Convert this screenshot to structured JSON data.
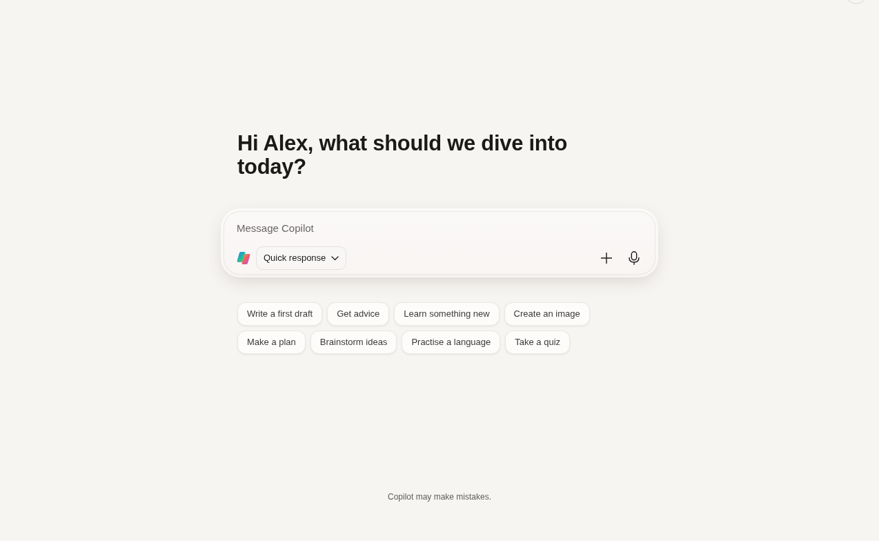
{
  "greeting": {
    "title": "Hi Alex, what should we dive into today?"
  },
  "composer": {
    "placeholder": "Message Copilot",
    "mode_dropdown": {
      "label": "Quick response"
    }
  },
  "suggestion_rows": [
    {
      "chips": [
        {
          "label": "Write a first draft"
        },
        {
          "label": "Get advice"
        },
        {
          "label": "Learn something new"
        },
        {
          "label": "Create an image"
        }
      ]
    },
    {
      "chips": [
        {
          "label": "Make a plan"
        },
        {
          "label": "Brainstorm ideas"
        },
        {
          "label": "Practise a language"
        },
        {
          "label": "Take a quiz"
        }
      ]
    }
  ],
  "footer": {
    "disclaimer": "Copilot may make mistakes."
  }
}
